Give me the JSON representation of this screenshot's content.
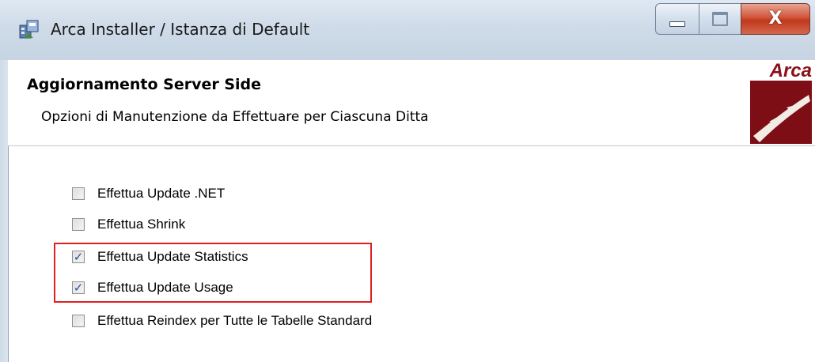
{
  "window": {
    "title": "Arca Installer / Istanza di Default",
    "icon": "installer-app-icon",
    "controls": {
      "minimize_icon": "minimize-icon",
      "maximize_icon": "maximize-icon",
      "close_label": "X"
    }
  },
  "header": {
    "title": "Aggiornamento Server Side",
    "subtitle": "Opzioni di Manutenzione da Effettuare per Ciascuna Ditta",
    "logo_text": "Arca",
    "logo_color": "#8a0f18"
  },
  "options": [
    {
      "label": "Effettua Update .NET",
      "checked": false
    },
    {
      "label": "Effettua Shrink",
      "checked": false
    },
    {
      "label": "Effettua Update Statistics",
      "checked": true
    },
    {
      "label": "Effettua Update Usage",
      "checked": true
    },
    {
      "label": "Effettua Reindex per Tutte le Tabelle Standard",
      "checked": false
    }
  ],
  "colors": {
    "highlight": "#e02020",
    "checkmark": "#2a4f9c",
    "close_button": "#c0391d"
  }
}
